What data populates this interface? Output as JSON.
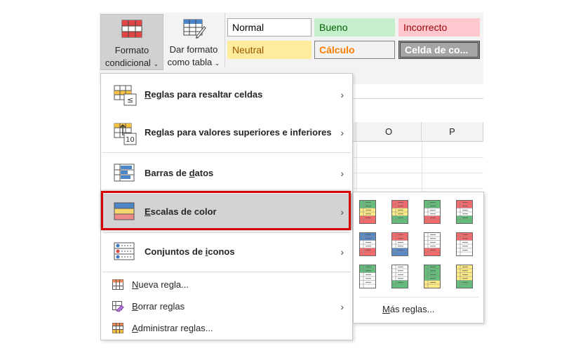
{
  "ribbon": {
    "conditional_format": {
      "line1": "Formato",
      "line2": "condicional",
      "caret": "⌄"
    },
    "format_table": {
      "line1": "Dar formato",
      "line2": "como tabla",
      "caret": "⌄"
    },
    "styles": {
      "normal": "Normal",
      "bueno": "Bueno",
      "incorrecto": "Incorrecto",
      "neutral": "Neutral",
      "calculo": "Cálculo",
      "celda": "Celda de co..."
    }
  },
  "sheet": {
    "columns": [
      "O",
      "P"
    ]
  },
  "menu": {
    "items": [
      {
        "prefix": "R",
        "label": "eglas para resaltar celdas",
        "arrow": "›",
        "icon": "highlight-cells-rules-icon"
      },
      {
        "prefix": "",
        "label": "Reglas para valores superiores e inferiores",
        "arrow": "›",
        "icon": "top-bottom-rules-icon"
      },
      {
        "prefix": "Barras de ",
        "underlined": "d",
        "suffix": "atos",
        "arrow": "›",
        "icon": "data-bars-icon"
      },
      {
        "prefix": "",
        "underlined": "E",
        "suffix": "scalas de color",
        "arrow": "›",
        "icon": "color-scales-icon"
      },
      {
        "prefix": "Conjuntos de ",
        "underlined": "i",
        "suffix": "conos",
        "arrow": "›",
        "icon": "icon-sets-icon"
      }
    ],
    "new_rule": {
      "u": "N",
      "rest": "ueva regla..."
    },
    "clear_rules": {
      "u": "B",
      "rest": "orrar reglas",
      "arrow": "›"
    },
    "manage_rules": {
      "u": "A",
      "rest": "dministrar reglas..."
    }
  },
  "submenu": {
    "more_rules": {
      "u": "M",
      "rest": "ás reglas..."
    },
    "scales": [
      [
        "#63be7b",
        "#ffeb84",
        "#f8696b"
      ],
      [
        "#f8696b",
        "#ffeb84",
        "#63be7b"
      ],
      [
        "#63be7b",
        "#ffffff",
        "#f8696b"
      ],
      [
        "#f8696b",
        "#ffffff",
        "#63be7b"
      ],
      [
        "#5a8ac6",
        "#ffffff",
        "#f8696b"
      ],
      [
        "#f8696b",
        "#ffffff",
        "#5a8ac6"
      ],
      [
        "#ffffff",
        "#ffffff",
        "#f8696b"
      ],
      [
        "#f8696b",
        "#ffffff",
        "#ffffff"
      ],
      [
        "#63be7b",
        "#ffffff",
        "#ffffff"
      ],
      [
        "#ffffff",
        "#ffffff",
        "#63be7b"
      ],
      [
        "#63be7b",
        "#63be7b",
        "#ffeb84"
      ],
      [
        "#ffeb84",
        "#ffeb84",
        "#63be7b"
      ]
    ]
  }
}
